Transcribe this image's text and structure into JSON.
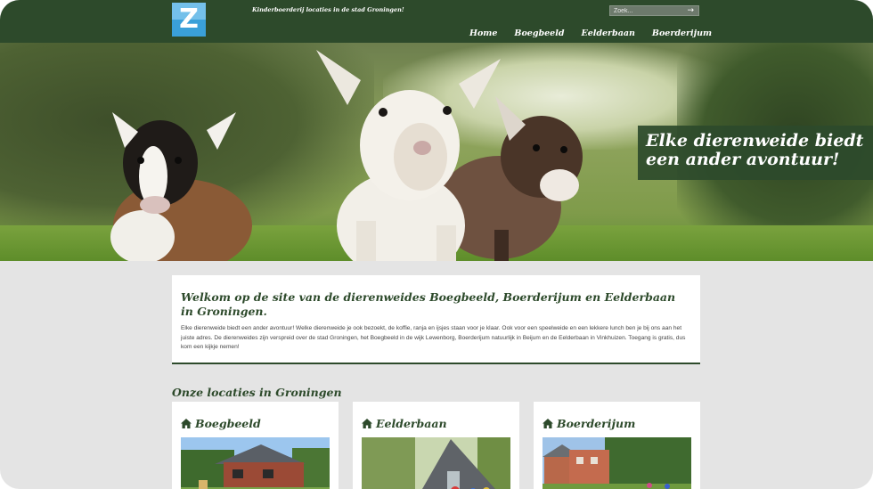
{
  "header": {
    "logo_letter": "Z",
    "tagline": "Kinderboerderij locaties in de stad Groningen!",
    "search": {
      "placeholder": "Zoek...",
      "arrow": "→"
    },
    "nav": [
      {
        "label": "Home"
      },
      {
        "label": "Boegbeeld"
      },
      {
        "label": "Eelderbaan"
      },
      {
        "label": "Boerderijum"
      }
    ]
  },
  "hero": {
    "caption_line1": "Elke dierenweide biedt",
    "caption_line2": "een ander avontuur!"
  },
  "welcome": {
    "title": "Welkom op de site van de dierenweides Boegbeeld, Boerderijum en Eelderbaan in Groningen.",
    "body": "Elke dierenweide biedt een ander avontuur! Welke dierenweide je ook bezoekt, de koffie, ranja en ijsjes staan voor je klaar. Ook voor een speelweide en een lekkere lunch ben je bij ons aan het juiste adres. De dierenweides zijn verspreid over de stad Groningen, het Boegbeeld in de wijk Lewenborg, Boerderijum natuurlijk in Beijum en de Eelderbaan in Vinkhuizen. Toegang is gratis, dus kom een kijkje nemen!"
  },
  "locations": {
    "title": "Onze locaties in Groningen",
    "cards": [
      {
        "name": "Boegbeeld"
      },
      {
        "name": "Eelderbaan"
      },
      {
        "name": "Boerderijum"
      }
    ]
  },
  "colors": {
    "brand_green": "#2d4a2b",
    "logo_blue": "#3aa0d9",
    "page_bg": "#e4e4e4"
  },
  "icons": [
    "home-icon",
    "arrow-right-icon"
  ]
}
